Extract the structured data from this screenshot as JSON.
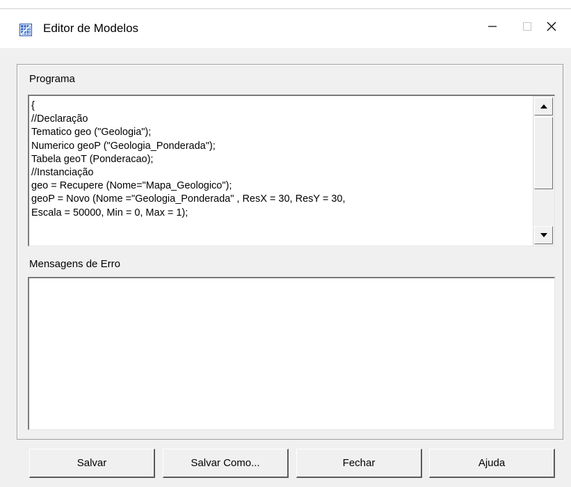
{
  "window": {
    "title": "Editor de Modelos",
    "icon": "model-editor-icon",
    "controls": {
      "minimize": "minimize-icon",
      "maximize": "maximize-icon",
      "close": "close-icon"
    }
  },
  "programa": {
    "label": "Programa",
    "lines": [
      "{",
      "//Declaração",
      "Tematico geo (\"Geologia\");",
      "Numerico geoP (\"Geologia_Ponderada\");",
      "Tabela geoT (Ponderacao);",
      "//Instanciação",
      "geo = Recupere (Nome=\"Mapa_Geologico\");",
      "geoP = Novo (Nome =\"Geologia_Ponderada\" , ResX = 30, ResY = 30,",
      "Escala = 50000, Min = 0, Max = 1);"
    ]
  },
  "mensagens": {
    "label": "Mensagens de Erro",
    "content": ""
  },
  "buttons": {
    "salvar": "Salvar",
    "salvar_como": "Salvar Como...",
    "fechar": "Fechar",
    "ajuda": "Ajuda"
  },
  "colors": {
    "dialog_bg": "#f0f0f0",
    "field_bg": "#ffffff",
    "icon_blue": "#1f4fa8"
  }
}
